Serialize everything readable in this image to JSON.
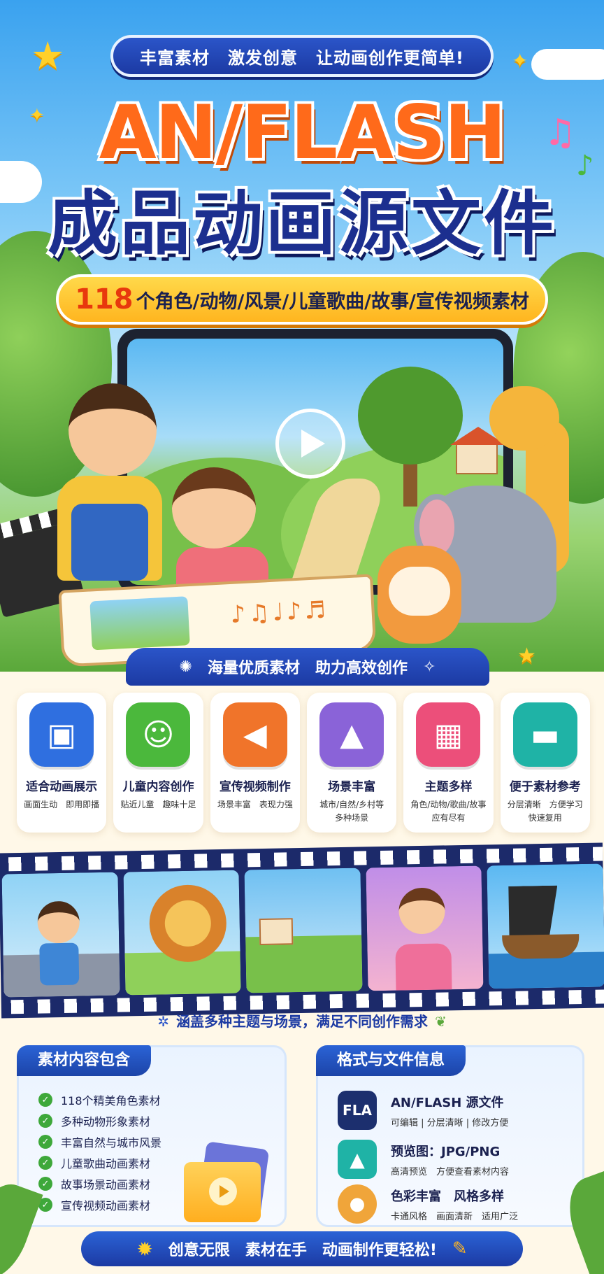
{
  "hero": {
    "top_banner": [
      "丰富素材",
      "激发创意",
      "让动画创作更简单!"
    ],
    "title_en": "AN/FLASH",
    "title_cn": "成品动画源文件",
    "subtitle_number": "118",
    "subtitle_text": "个角色/动物/风景/儿童歌曲/故事/宣传视频素材",
    "ribbon": [
      "海量优质素材",
      "助力高效创作"
    ],
    "play_icon": "play-icon"
  },
  "features": [
    {
      "icon": "film-icon",
      "color": "#2f6fe0",
      "title": "适合动画展示",
      "desc": "画面生动　即用即播"
    },
    {
      "icon": "child-face-icon",
      "color": "#4bb83c",
      "title": "儿童内容创作",
      "desc": "贴近儿童　趣味十足"
    },
    {
      "icon": "megaphone-icon",
      "color": "#f0742a",
      "title": "宣传视频制作",
      "desc": "场景丰富　表现力强"
    },
    {
      "icon": "landscape-icon",
      "color": "#8a63d8",
      "title": "场景丰富",
      "desc": "城市/自然/乡村等\n多种场景"
    },
    {
      "icon": "grid-icon",
      "color": "#ec4f7a",
      "title": "主题多样",
      "desc": "角色/动物/歌曲/故事\n应有尽有"
    },
    {
      "icon": "folder-icon",
      "color": "#1fb3a6",
      "title": "便于素材参考",
      "desc": "分层清晰　方便学习\n快速复用"
    }
  ],
  "film_caption": "涵盖多种主题与场景，满足不同创作需求",
  "content_panel": {
    "title": "素材内容包含",
    "items": [
      "118个精美角色素材",
      "多种动物形象素材",
      "丰富自然与城市风景",
      "儿童歌曲动画素材",
      "故事场景动画素材",
      "宣传视频动画素材"
    ]
  },
  "format_panel": {
    "title": "格式与文件信息",
    "rows": [
      {
        "icon_label": "FLA",
        "color": "#1c2f6e",
        "title": "AN/FLASH 源文件",
        "sub": "可编辑 | 分层清晰 | 修改方便"
      },
      {
        "icon_label": "",
        "color": "#1fb3a6",
        "title": "预览图：JPG/PNG",
        "sub": "高清预览　方便查看素材内容"
      },
      {
        "icon_label": "",
        "color": "#f0a53a",
        "title": "色彩丰富　风格多样",
        "sub": "卡通风格　画面清新　适用广泛"
      }
    ]
  },
  "bottom_bar": [
    "创意无限",
    "素材在手",
    "动画制作更轻松!"
  ]
}
